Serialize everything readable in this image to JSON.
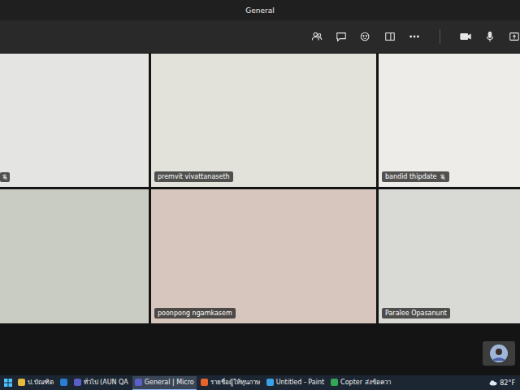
{
  "window": {
    "title": "General"
  },
  "toolbar": {
    "buttons": [
      {
        "name": "participants"
      },
      {
        "name": "chat"
      },
      {
        "name": "reactions"
      },
      {
        "name": "view"
      },
      {
        "name": "more"
      },
      {
        "name": "camera"
      },
      {
        "name": "mic"
      },
      {
        "name": "share"
      }
    ]
  },
  "participants": [
    {
      "name": "",
      "muted": true
    },
    {
      "name": "premvit vivattanaseth",
      "muted": false
    },
    {
      "name": "bandid thipdate",
      "muted": true
    },
    {
      "name": "",
      "muted": false
    },
    {
      "name": "poonpong ngamkasem",
      "muted": false
    },
    {
      "name": "Paralee Opasanunt",
      "muted": false
    }
  ],
  "taskbar": {
    "items": [
      {
        "label": "ป.บัณฑิต",
        "selected": false,
        "color": "#e8b93a"
      },
      {
        "label": "",
        "selected": false,
        "color": "#2b7cd3"
      },
      {
        "label": "ทั่วไป (AUN QA",
        "selected": false,
        "color": "#5b5fc7"
      },
      {
        "label": "General | Micro",
        "selected": true,
        "color": "#5b5fc7"
      },
      {
        "label": "รายชื่อผู้ให้ทุนภาษ",
        "selected": false,
        "color": "#e8632b"
      },
      {
        "label": "Untitled - Paint",
        "selected": false,
        "color": "#3aa0e8"
      },
      {
        "label": "Copter ส่งข้อควา",
        "selected": false,
        "color": "#34a853"
      }
    ],
    "weather": "82°F"
  }
}
